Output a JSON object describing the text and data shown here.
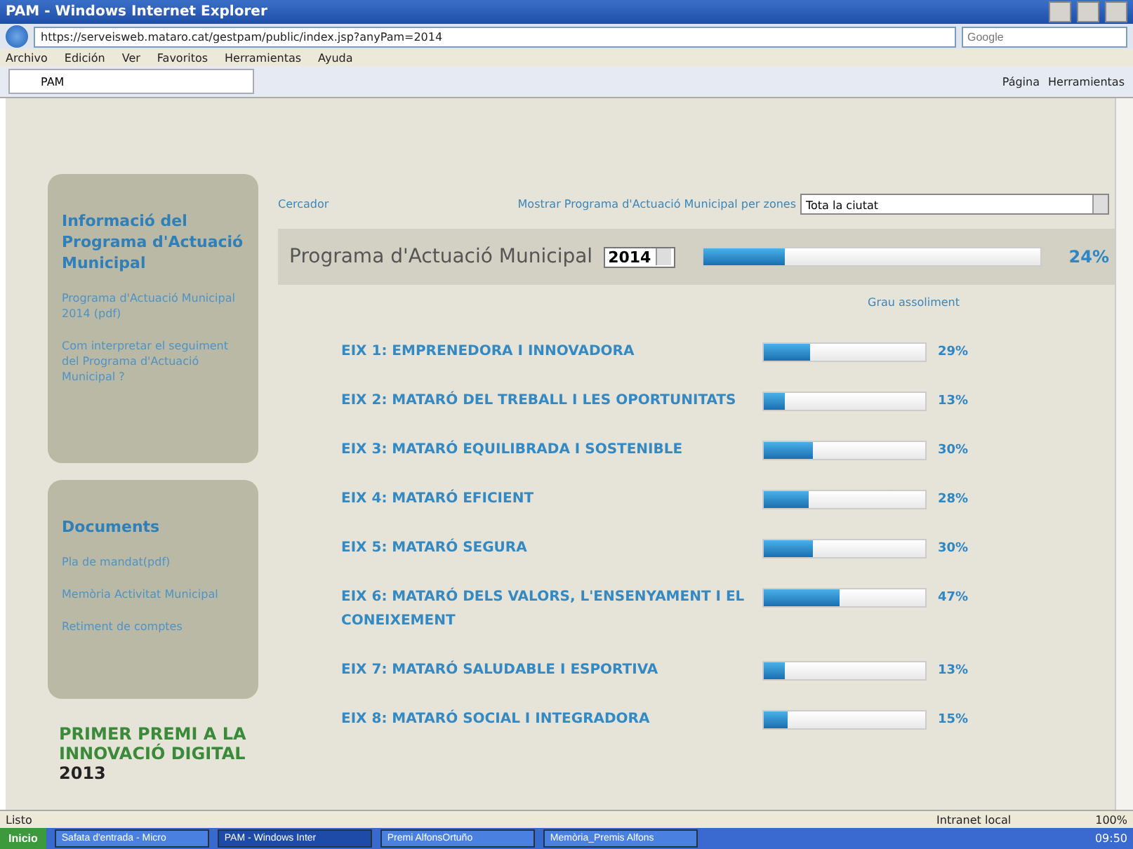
{
  "window": {
    "title": "PAM - Windows Internet Explorer"
  },
  "address_bar": {
    "url": "https://serveisweb.mataro.cat/gestpam/public/index.jsp?anyPam=2014",
    "search_placeholder": "Google"
  },
  "menu": [
    "Archivo",
    "Edición",
    "Ver",
    "Favoritos",
    "Herramientas",
    "Ayuda"
  ],
  "tab": {
    "label": "PAM",
    "selected": true
  },
  "command_bar": [
    "Página",
    "Herramientas"
  ],
  "sidebar": {
    "sections": [
      {
        "title": "Informació del Programa d'Actuació Municipal",
        "links": [
          "Programa d'Actuació Municipal 2014 (pdf)",
          "Com interpretar el seguiment del Programa d'Actuació Municipal ?"
        ]
      },
      {
        "title": "Documents",
        "links": [
          "Pla de mandat(pdf)",
          "Memòria Activitat Municipal",
          "Retiment de comptes"
        ]
      }
    ],
    "award": [
      "PRIMER PREMI A LA",
      "INNOVACIÓ DIGITAL",
      "2013"
    ]
  },
  "search_link": "Cercador",
  "zone_filter": {
    "label": "Mostrar Programa d'Actuació Municipal per zones",
    "value": "Tota la ciutat"
  },
  "summary": {
    "title": "Programa d'Actuació Municipal",
    "year": "2014",
    "level": 0.24,
    "reading": "24%"
  },
  "column_header": "Grau assoliment",
  "axes": [
    {
      "name": "EIX 1: EMPRENEDORA I INNOVADORA",
      "level": 0.29,
      "reading": "29%"
    },
    {
      "name": "EIX 2: MATARÓ DEL TREBALL I LES OPORTUNITATS",
      "level": 0.13,
      "reading": "13%"
    },
    {
      "name": "EIX 3: MATARÓ EQUILIBRADA I SOSTENIBLE",
      "level": 0.3,
      "reading": "30%"
    },
    {
      "name": "EIX 4: MATARÓ EFICIENT",
      "level": 0.28,
      "reading": "28%"
    },
    {
      "name": "EIX 5: MATARÓ SEGURA",
      "level": 0.3,
      "reading": "30%"
    },
    {
      "name": "EIX 6: MATARÓ DELS VALORS, L'ENSENYAMENT I EL CONEIXEMENT",
      "level": 0.47,
      "reading": "47%"
    },
    {
      "name": "EIX 7: MATARÓ SALUDABLE I ESPORTIVA",
      "level": 0.13,
      "reading": "13%"
    },
    {
      "name": "EIX 8: MATARÓ SOCIAL I INTEGRADORA",
      "level": 0.15,
      "reading": "15%"
    }
  ],
  "status_bar": {
    "text": "Listo",
    "zone": "Intranet local",
    "zoom": "100%"
  },
  "taskbar": {
    "start": "Inicio",
    "tasks": [
      {
        "label": "Safata d'entrada - Micro",
        "selected": false
      },
      {
        "label": "PAM - Windows Inter",
        "selected": true
      },
      {
        "label": "Premi AlfonsOrtuño",
        "selected": false
      },
      {
        "label": "Memòria_Premis Alfons",
        "selected": false
      }
    ],
    "clock": "09:50"
  }
}
